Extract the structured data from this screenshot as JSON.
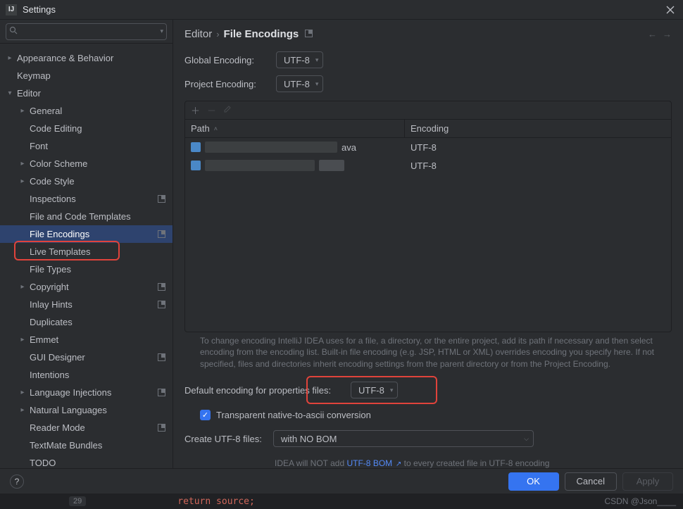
{
  "window": {
    "title": "Settings"
  },
  "search": {
    "placeholder": ""
  },
  "tree": [
    {
      "label": "Appearance & Behavior",
      "depth": 0,
      "chev": "right",
      "modified": false
    },
    {
      "label": "Keymap",
      "depth": 0,
      "chev": "none",
      "modified": false
    },
    {
      "label": "Editor",
      "depth": 0,
      "chev": "down",
      "modified": false
    },
    {
      "label": "General",
      "depth": 1,
      "chev": "right",
      "modified": false
    },
    {
      "label": "Code Editing",
      "depth": 1,
      "chev": "none",
      "modified": false
    },
    {
      "label": "Font",
      "depth": 1,
      "chev": "none",
      "modified": false
    },
    {
      "label": "Color Scheme",
      "depth": 1,
      "chev": "right",
      "modified": false
    },
    {
      "label": "Code Style",
      "depth": 1,
      "chev": "right",
      "modified": false
    },
    {
      "label": "Inspections",
      "depth": 1,
      "chev": "none",
      "modified": true
    },
    {
      "label": "File and Code Templates",
      "depth": 1,
      "chev": "none",
      "modified": false
    },
    {
      "label": "File Encodings",
      "depth": 1,
      "chev": "none",
      "modified": true,
      "selected": true
    },
    {
      "label": "Live Templates",
      "depth": 1,
      "chev": "none",
      "modified": false
    },
    {
      "label": "File Types",
      "depth": 1,
      "chev": "none",
      "modified": false
    },
    {
      "label": "Copyright",
      "depth": 1,
      "chev": "right",
      "modified": true
    },
    {
      "label": "Inlay Hints",
      "depth": 1,
      "chev": "none",
      "modified": true
    },
    {
      "label": "Duplicates",
      "depth": 1,
      "chev": "none",
      "modified": false
    },
    {
      "label": "Emmet",
      "depth": 1,
      "chev": "right",
      "modified": false
    },
    {
      "label": "GUI Designer",
      "depth": 1,
      "chev": "none",
      "modified": true
    },
    {
      "label": "Intentions",
      "depth": 1,
      "chev": "none",
      "modified": false
    },
    {
      "label": "Language Injections",
      "depth": 1,
      "chev": "right",
      "modified": true
    },
    {
      "label": "Natural Languages",
      "depth": 1,
      "chev": "right",
      "modified": false
    },
    {
      "label": "Reader Mode",
      "depth": 1,
      "chev": "none",
      "modified": true
    },
    {
      "label": "TextMate Bundles",
      "depth": 1,
      "chev": "none",
      "modified": false
    },
    {
      "label": "TODO",
      "depth": 1,
      "chev": "none",
      "modified": false
    }
  ],
  "breadcrumb": {
    "parent": "Editor",
    "current": "File Encodings"
  },
  "form": {
    "global_label": "Global Encoding:",
    "global_value": "UTF-8",
    "project_label": "Project Encoding:",
    "project_value": "UTF-8"
  },
  "table": {
    "col_path": "Path",
    "col_enc": "Encoding",
    "rows": [
      {
        "suffix": "ava",
        "encoding": "UTF-8",
        "redact1_w": 188,
        "redact2_w": 0
      },
      {
        "suffix": "",
        "encoding": "UTF-8",
        "redact1_w": 156,
        "redact2_w": 36
      }
    ]
  },
  "hint": "To change encoding IntelliJ IDEA uses for a file, a directory, or the entire project, add its path if necessary and then select encoding from the encoding list. Built-in file encoding (e.g. JSP, HTML or XML) overrides encoding you specify here. If not specified, files and directories inherit encoding settings from the parent directory or from the Project Encoding.",
  "default_props": {
    "label": "Default encoding for properties files:",
    "value": "UTF-8"
  },
  "checkbox": {
    "label": "Transparent native-to-ascii conversion",
    "checked": true
  },
  "create_utf": {
    "label": "Create UTF-8 files:",
    "value": "with NO BOM"
  },
  "hint2": {
    "prefix": "IDEA will NOT add ",
    "link": "UTF-8 BOM",
    "suffix": " to every created file in UTF-8 encoding"
  },
  "buttons": {
    "ok": "OK",
    "cancel": "Cancel",
    "apply": "Apply"
  },
  "watermark": "CSDN @Json____",
  "status": {
    "line": "29",
    "code": "return  source;"
  }
}
